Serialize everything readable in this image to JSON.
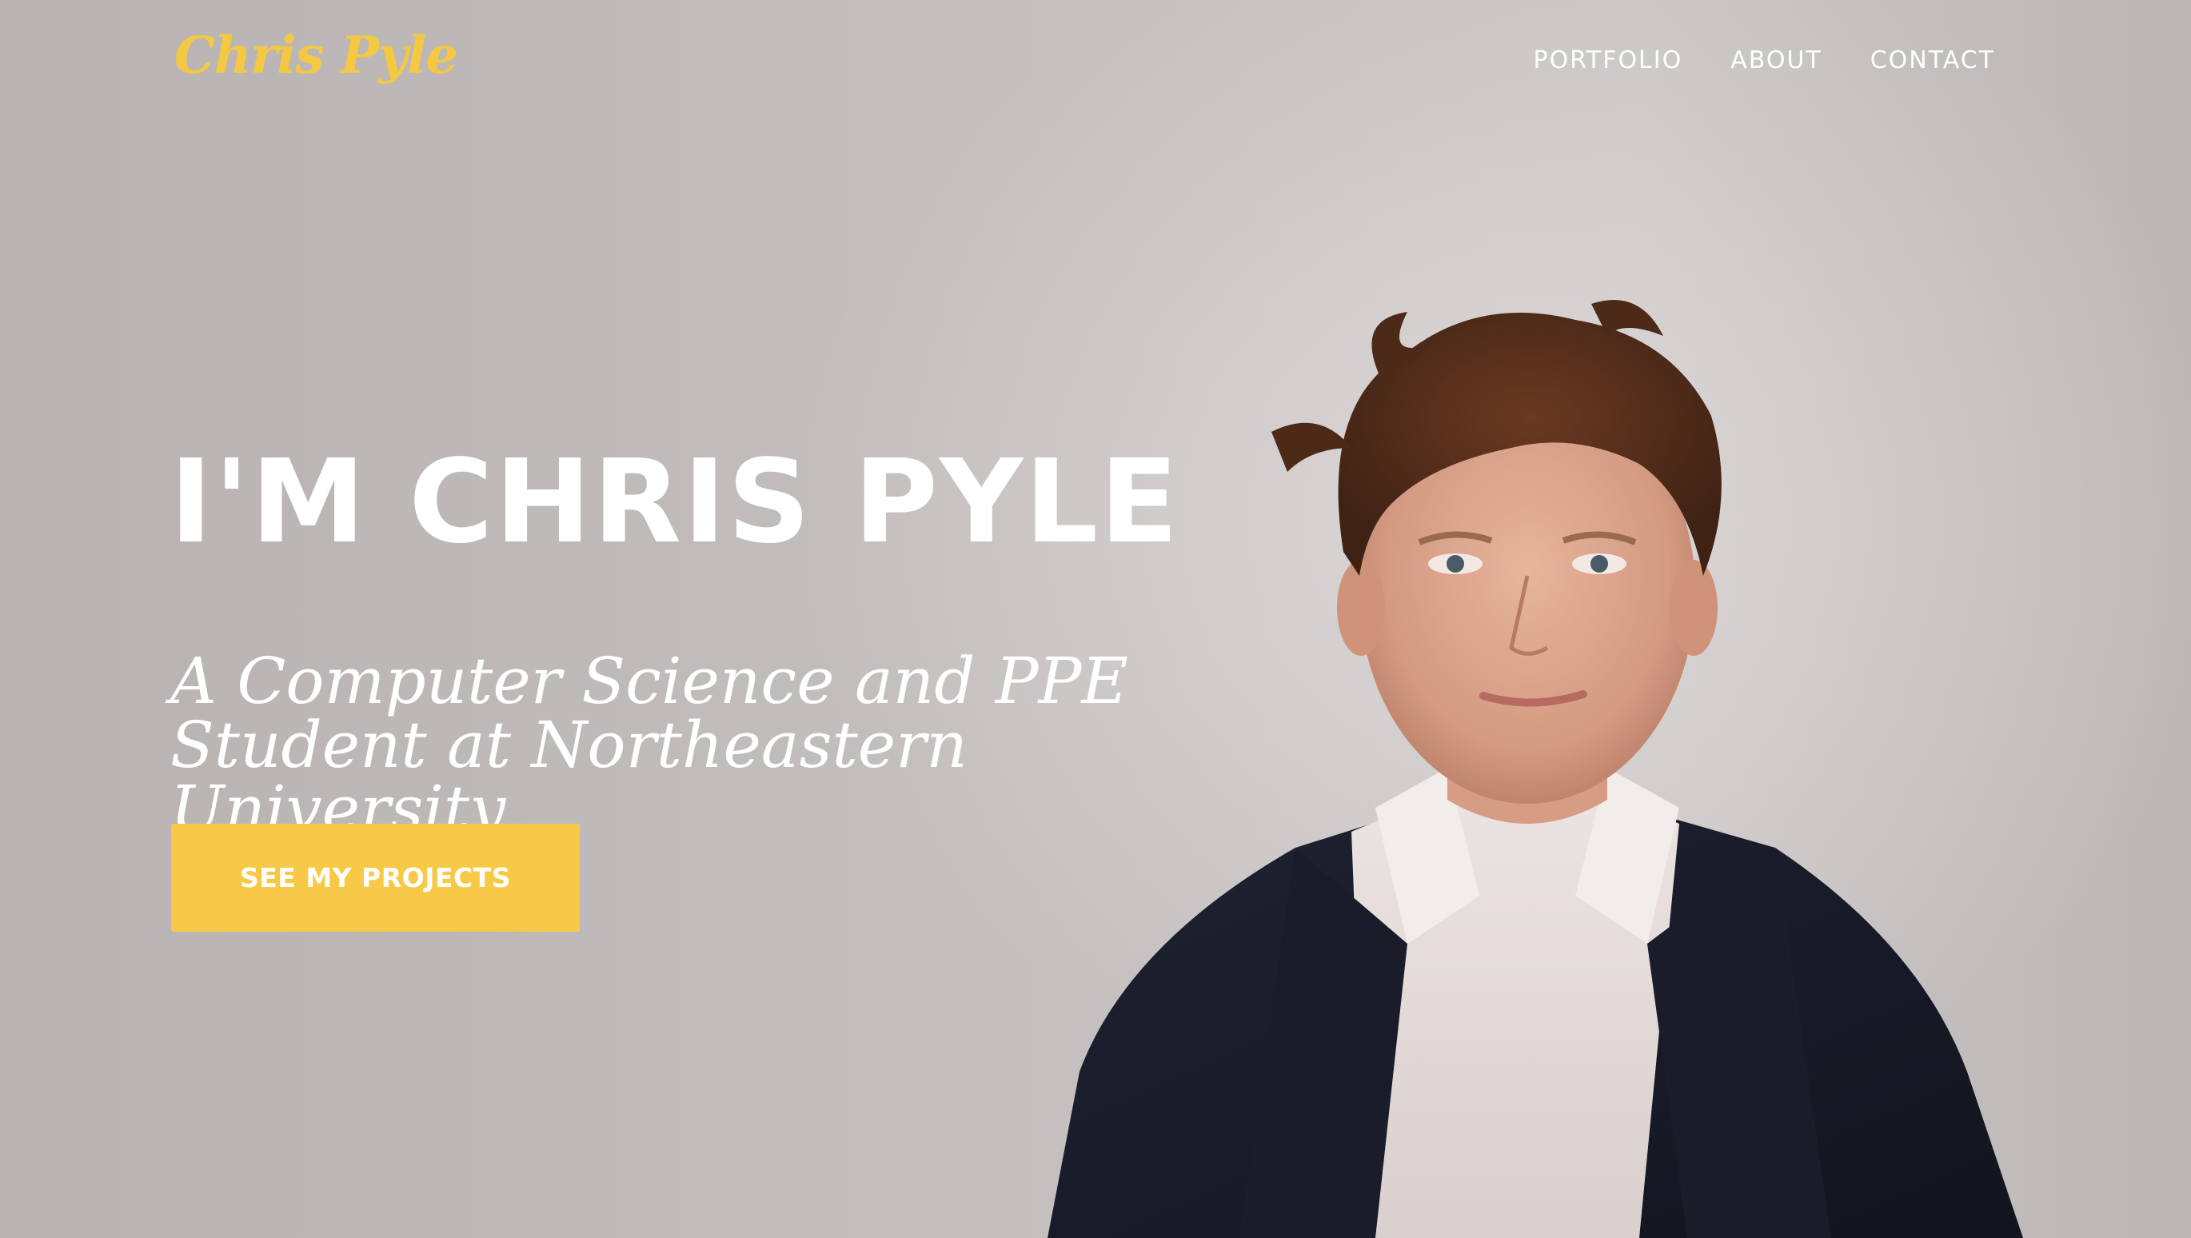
{
  "nav": {
    "logo": "Chris Pyle",
    "links": [
      "PORTFOLIO",
      "ABOUT",
      "CONTACT"
    ]
  },
  "hero": {
    "title": "I'M CHRIS PYLE",
    "subtitle_line1": "A Computer Science and PPE",
    "subtitle_line2": "Student at Northeastern University",
    "cta_label": "SEE MY PROJECTS"
  },
  "colors": {
    "accent": "#f7c947",
    "background": "#bdb8b7",
    "text": "#ffffff"
  }
}
